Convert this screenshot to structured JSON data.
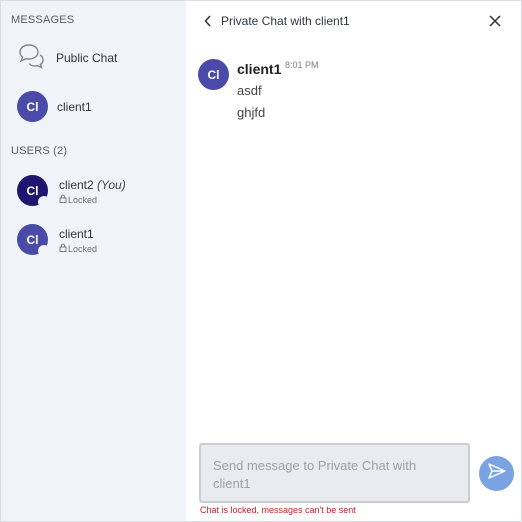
{
  "sidebar": {
    "messages_title": "MESSAGES",
    "public_chat_label": "Public Chat",
    "chats": [
      {
        "initials": "Cl",
        "name": "client1"
      }
    ],
    "users_title": "USERS (2)",
    "users": [
      {
        "initials": "Cl",
        "name": "client2",
        "you_label": "(You)",
        "status": "Locked"
      },
      {
        "initials": "Cl",
        "name": "client1",
        "status": "Locked"
      }
    ]
  },
  "chat": {
    "title": "Private Chat with client1",
    "messages": [
      {
        "initials": "Cl",
        "author": "client1",
        "time": "8:01 PM",
        "lines": [
          "asdf",
          "ghjfd"
        ]
      }
    ],
    "composer_placeholder": "Send message to Private Chat with client1",
    "locked_warning": "Chat is locked, messages can't be sent"
  },
  "colors": {
    "sidebar_bg": "#f0f3f7",
    "avatar": "#4a4aa8",
    "avatar_self": "#1e1670",
    "send_button": "#7ba3e2",
    "warning": "#c02626"
  }
}
